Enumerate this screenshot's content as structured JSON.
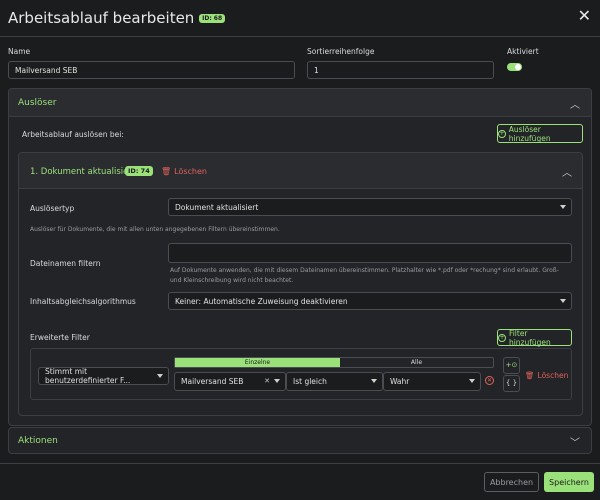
{
  "header": {
    "title": "Arbeitsablauf bearbeiten",
    "id_badge": "ID: 68",
    "close": "✕"
  },
  "form": {
    "name_label": "Name",
    "name_value": "Mailversand SEB",
    "sort_label": "Sortierreihenfolge",
    "sort_value": "1",
    "active_label": "Aktiviert",
    "active": true
  },
  "triggers": {
    "section_title": "Auslöser",
    "trigger_on_label": "Arbeitsablauf auslösen bei:",
    "add_button": "Auslöser hinzufügen",
    "trigger": {
      "title": "1. Dokument aktualisiert",
      "id_badge": "ID: 74",
      "delete": "Löschen",
      "type_label": "Auslösertyp",
      "type_value": "Dokument aktualisiert",
      "type_help": "Auslöser für Dokumente, die mit allen unten angegebenen Filtern übereinstimmen.",
      "filename_label": "Dateinamen filtern",
      "filename_help": "Auf Dokumente anwenden, die mit diesem Dateinamen übereinstimmen. Platzhalter wie *.pdf oder *rechung* sind erlaubt. Groß- und Kleinschreibung wird nicht beachtet.",
      "match_label": "Inhaltsabgleichsalgorithmus",
      "match_value": "Keiner: Automatische Zuweisung deaktivieren",
      "adv_label": "Erweiterte Filter",
      "add_filter": "Filter hinzufügen",
      "filter": {
        "field": "Stimmt mit benutzerdefinierter F...",
        "tab_single": "Einzelne",
        "tab_all": "Alle",
        "custom_field": "Mailversand SEB",
        "operator": "Ist gleich",
        "value": "Wahr",
        "delete": "Löschen"
      }
    }
  },
  "actions": {
    "section_title": "Aktionen"
  },
  "footer": {
    "cancel": "Abbrechen",
    "save": "Speichern"
  },
  "colors": {
    "accent": "#9be17a",
    "danger": "#e0625c",
    "background": "#1b1c1e"
  }
}
